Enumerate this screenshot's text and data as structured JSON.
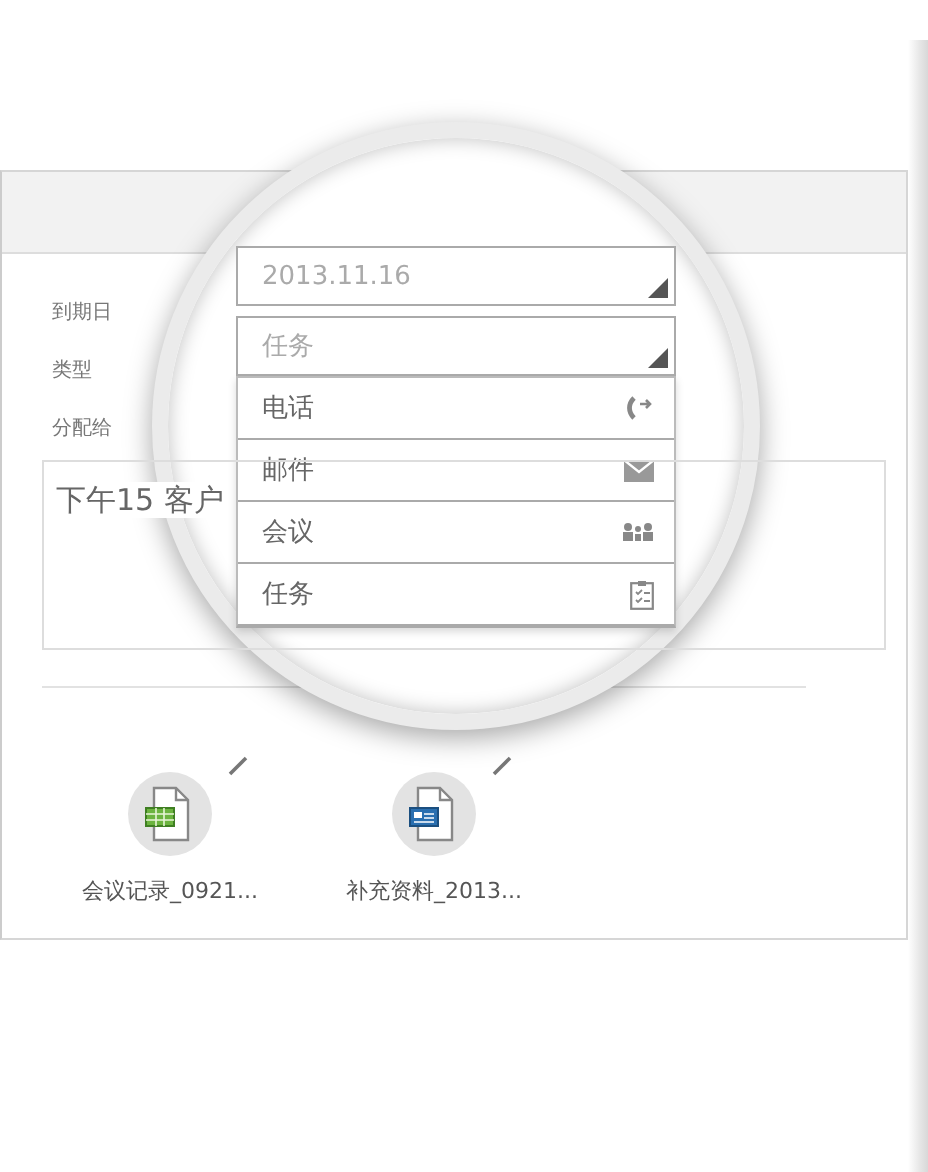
{
  "form": {
    "fields": [
      {
        "label": "到期日"
      },
      {
        "label": "类型"
      },
      {
        "label": "分配给"
      }
    ]
  },
  "note": "下午15 客户",
  "attachments": [
    {
      "name": "会议记录_0921...",
      "kind": "spreadsheet"
    },
    {
      "name": "补充资料_2013...",
      "kind": "document"
    }
  ],
  "magnifier": {
    "date_field": {
      "value": "2013.11.16"
    },
    "type_field": {
      "value": "任务"
    },
    "options": [
      {
        "label": "电话",
        "kind": "phone"
      },
      {
        "label": "邮件",
        "kind": "mail"
      },
      {
        "label": "会议",
        "kind": "meeting"
      },
      {
        "label": "任务",
        "kind": "task"
      }
    ]
  }
}
